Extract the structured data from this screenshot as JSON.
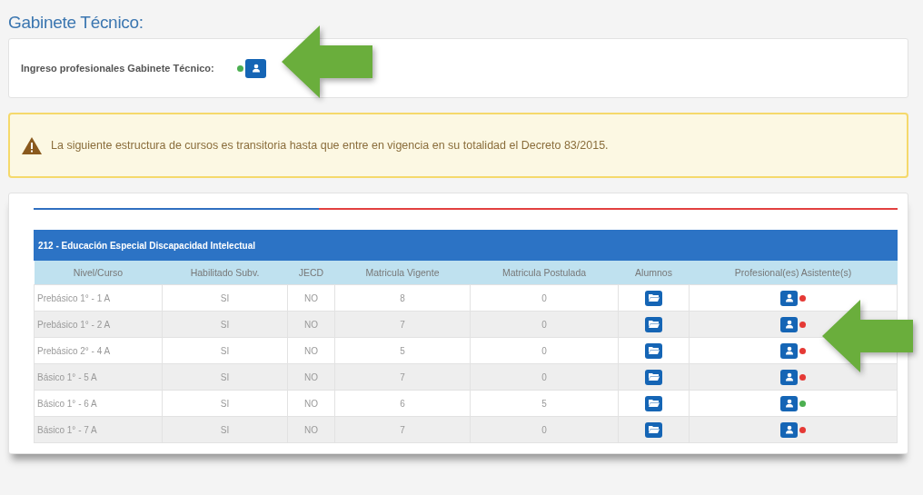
{
  "section_title": "Gabinete Técnico:",
  "professionals": {
    "label": "Ingreso profesionales Gabinete Técnico:",
    "color": "#4caf50"
  },
  "warning": {
    "text": "La siguiente estructura de cursos es transitoria hasta que entre en vigencia en su totalidad el Decreto 83/2015."
  },
  "table": {
    "title": "212 - Educación Especial Discapacidad Intelectual",
    "columns": [
      "Nivel/Curso",
      "Habilitado Subv.",
      "JECD",
      "Matricula Vigente",
      "Matricula Postulada",
      "Alumnos",
      "Profesional(es) Asistente(s)"
    ],
    "rows": [
      {
        "cells": [
          "Prebásico 1° - 1 A",
          "SI",
          "NO",
          "8",
          "0"
        ],
        "color": "#e53935"
      },
      {
        "cells": [
          "Prebásico 1° - 2 A",
          "SI",
          "NO",
          "7",
          "0"
        ],
        "color": "#e53935"
      },
      {
        "cells": [
          "Prebásico 2° - 4 A",
          "SI",
          "NO",
          "5",
          "0"
        ],
        "color": "#e53935"
      },
      {
        "cells": [
          "Básico 1° - 5 A",
          "SI",
          "NO",
          "7",
          "0"
        ],
        "color": "#e53935"
      },
      {
        "cells": [
          "Básico 1° - 6 A",
          "SI",
          "NO",
          "6",
          "5"
        ],
        "color": "#4caf50"
      },
      {
        "cells": [
          "Básico 1° - 7 A",
          "SI",
          "NO",
          "7",
          "0"
        ],
        "color": "#e53935"
      }
    ]
  }
}
